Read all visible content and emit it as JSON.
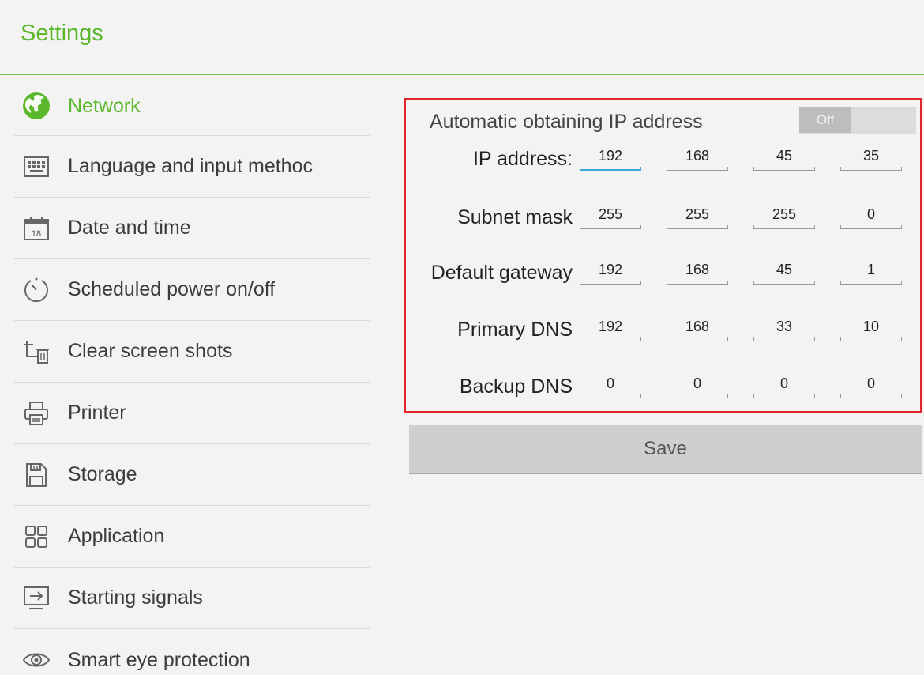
{
  "header": {
    "title": "Settings"
  },
  "sidebar": {
    "items": [
      {
        "label": "Network",
        "icon": "globe-icon"
      },
      {
        "label": "Language and input methoc",
        "icon": "keyboard-icon"
      },
      {
        "label": "Date and time",
        "icon": "calendar-icon",
        "icon_text": "18"
      },
      {
        "label": "Scheduled power on/off",
        "icon": "timer-icon"
      },
      {
        "label": "Clear screen shots",
        "icon": "crop-trash-icon"
      },
      {
        "label": "Printer",
        "icon": "printer-icon"
      },
      {
        "label": "Storage",
        "icon": "storage-icon"
      },
      {
        "label": "Application",
        "icon": "apps-grid-icon"
      },
      {
        "label": "Starting signals",
        "icon": "input-signal-icon"
      },
      {
        "label": "Smart eye protection",
        "icon": "eye-icon"
      }
    ]
  },
  "network": {
    "auto_ip_label": "Automatic obtaining IP address",
    "auto_ip_toggle": "Off",
    "rows": [
      {
        "label": "IP address:",
        "octets": [
          "192",
          "168",
          "45",
          "35"
        ]
      },
      {
        "label": "Subnet mask",
        "octets": [
          "255",
          "255",
          "255",
          "0"
        ]
      },
      {
        "label": "Default gateway",
        "octets": [
          "192",
          "168",
          "45",
          "1"
        ]
      },
      {
        "label": "Primary DNS",
        "octets": [
          "192",
          "168",
          "33",
          "10"
        ]
      },
      {
        "label": "Backup DNS",
        "octets": [
          "0",
          "0",
          "0",
          "0"
        ]
      }
    ],
    "save_label": "Save"
  },
  "colors": {
    "accent": "#5bb82a",
    "highlight_border": "#e0242b",
    "focus": "#3aa6d8"
  }
}
